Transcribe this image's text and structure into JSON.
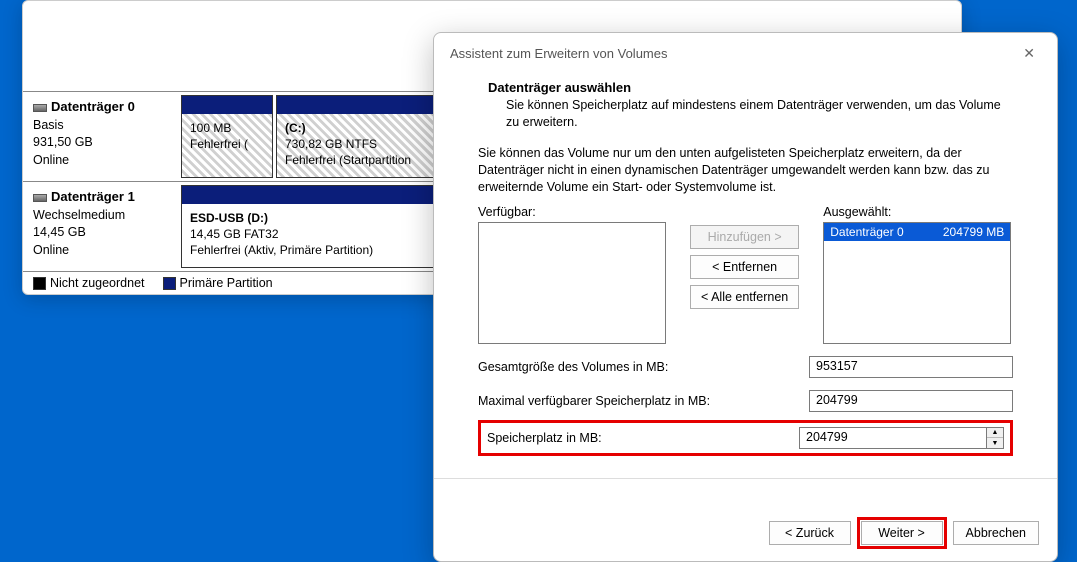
{
  "diskmgmt": {
    "disk0": {
      "name": "Datenträger 0",
      "type": "Basis",
      "size": "931,50 GB",
      "status": "Online",
      "part_a_size": "100 MB",
      "part_a_status": "Fehlerfrei (",
      "part_b_label": "(C:)",
      "part_b_size": "730,82 GB NTFS",
      "part_b_status": "Fehlerfrei (Startpartition"
    },
    "disk1": {
      "name": "Datenträger 1",
      "type": "Wechselmedium",
      "size": "14,45 GB",
      "status": "Online",
      "part_label": "ESD-USB  (D:)",
      "part_size": "14,45 GB FAT32",
      "part_status": "Fehlerfrei (Aktiv, Primäre Partition)"
    },
    "legend_unalloc": "Nicht zugeordnet",
    "legend_primary": "Primäre Partition"
  },
  "wizard": {
    "title": "Assistent zum Erweitern von Volumes",
    "heading": "Datenträger auswählen",
    "subheading": "Sie können Speicherplatz auf mindestens einem Datenträger verwenden, um das Volume zu erweitern.",
    "explain": "Sie können das Volume nur um den unten aufgelisteten Speicherplatz erweitern, da der Datenträger nicht in einen dynamischen Datenträger umgewandelt werden kann bzw. das zu erweiternde Volume ein Start- oder Systemvolume ist.",
    "available_label": "Verfügbar:",
    "selected_label": "Ausgewählt:",
    "selected_item_name": "Datenträger 0",
    "selected_item_size": "204799 MB",
    "btn_add": "Hinzufügen >",
    "btn_remove": "< Entfernen",
    "btn_remove_all": "< Alle entfernen",
    "total_label": "Gesamtgröße des Volumes in MB:",
    "total_value": "953157",
    "max_label": "Maximal verfügbarer Speicherplatz in MB:",
    "max_value": "204799",
    "space_label": "Speicherplatz in MB:",
    "space_value": "204799",
    "btn_back": "< Zurück",
    "btn_next": "Weiter >",
    "btn_cancel": "Abbrechen"
  }
}
